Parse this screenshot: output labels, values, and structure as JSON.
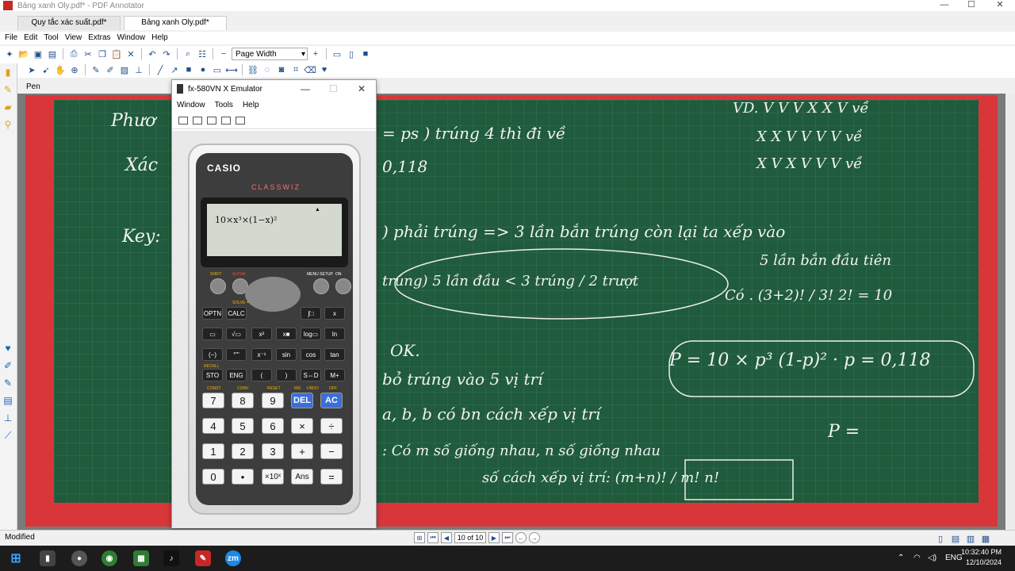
{
  "window": {
    "title": "Bảng xanh Oly.pdf* - PDF Annotator",
    "min": "—",
    "max": "☐",
    "close": "✕"
  },
  "tabs": [
    {
      "label": "Quy tắc xác suất.pdf*"
    },
    {
      "label": "Bảng xanh Oly.pdf*"
    }
  ],
  "menu": [
    "File",
    "Edit",
    "Tool",
    "View",
    "Extras",
    "Window",
    "Help"
  ],
  "toolbar": {
    "zoom": "Page Width",
    "pen_label": "Pen"
  },
  "board": {
    "lines": [
      {
        "text": "Phươ"
      },
      {
        "text": "Xác"
      },
      {
        "text": "Key:"
      },
      {
        "text": "= ps  )    trúng 4 thì đi về"
      },
      {
        "text": "0,118"
      },
      {
        "text": "VD.  V V V X X V   về"
      },
      {
        "text": "X X V V V V   về"
      },
      {
        "text": "X V X V V V   về"
      },
      {
        "text": ") phải trúng => 3 lần bắn trúng còn lại ta xếp vào"
      },
      {
        "text": "5 lần bắn đầu tiên"
      },
      {
        "text": "trúng)     5 lần đầu < 3 trúng / 2 trượt"
      },
      {
        "text": "Có . (3+2)! / 3! 2! = 10"
      },
      {
        "text": "OK."
      },
      {
        "text": "P = 10 × p³ (1-p)² · p = 0,118"
      },
      {
        "text": "bỏ trúng vào 5 vị trí"
      },
      {
        "text": "a, b, b  có bn cách xếp vị trí"
      },
      {
        "text": "P ="
      },
      {
        "text": ":  Có m số giống nhau, n số giống nhau"
      },
      {
        "text": "số cách xếp vị trí: (m+n)! / m! n!"
      }
    ]
  },
  "emulator": {
    "title": "fx-580VN X Emulator",
    "menu": [
      "Window",
      "Tools",
      "Help"
    ],
    "brand": "CASIO",
    "model": "CLASSWIZ",
    "display": "10×x³×(1−x)²",
    "indicator": "▲",
    "keys_row1": [
      "OPTN",
      "CALC",
      "∫□",
      "x"
    ],
    "keys_row2": [
      "▭",
      "√▭",
      "x²",
      "x■",
      "log▭",
      "ln"
    ],
    "keys_row3": [
      "(−)",
      "°'\"",
      "x⁻¹",
      "sin",
      "cos",
      "tan"
    ],
    "keys_row4": [
      "STO",
      "ENG",
      "(",
      ")",
      "S⇔D",
      "M+"
    ],
    "num_row1": [
      "7",
      "8",
      "9",
      "DEL",
      "AC"
    ],
    "num_row2": [
      "4",
      "5",
      "6",
      "×",
      "÷"
    ],
    "num_row3": [
      "1",
      "2",
      "3",
      "+",
      "−"
    ],
    "num_row4": [
      "0",
      "•",
      "×10ˣ",
      "Ans",
      "="
    ],
    "labels": {
      "shift": "SHIFT",
      "alpha": "ALPHA",
      "menu": "MENU SETUP",
      "on": "ON",
      "solve": "SOLVE =",
      "const": "CONST",
      "conv": "CONV",
      "reset": "RESET",
      "ins": "INS",
      "undo": "UNDO",
      "off": "OFF",
      "recall": "RECALL"
    }
  },
  "status": {
    "left": "Modified",
    "page": "10 of 10"
  },
  "tray": {
    "lang": "ENG",
    "time": "10:32:40 PM",
    "date": "12/10/2024"
  }
}
